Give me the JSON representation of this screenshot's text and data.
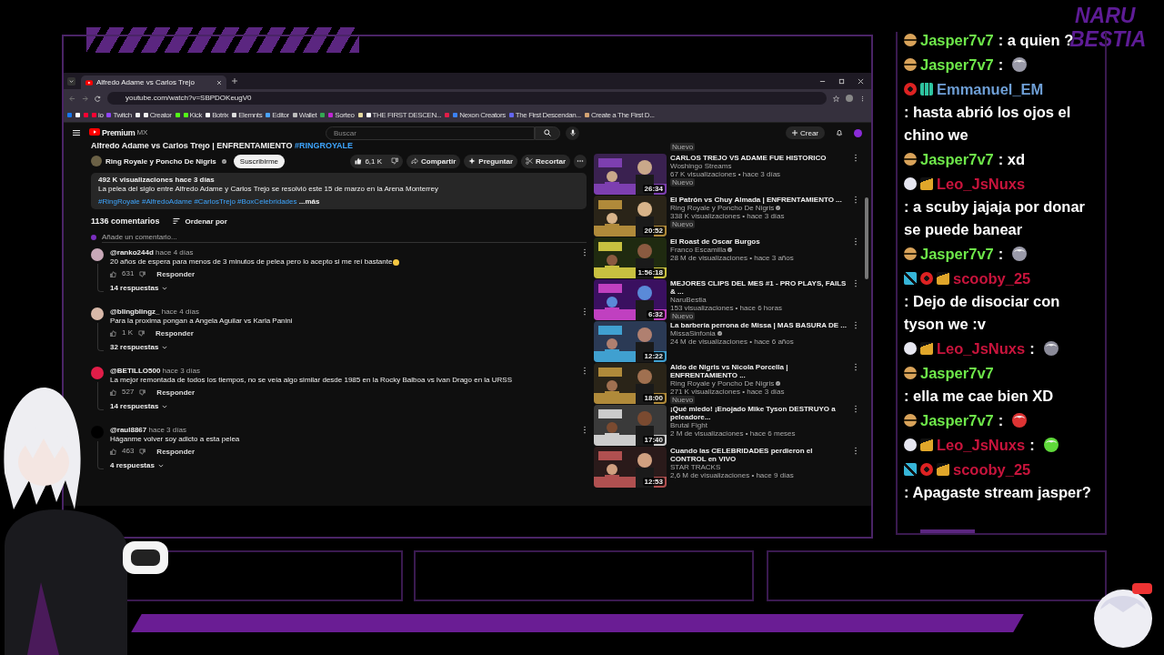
{
  "logo": {
    "line_1": "NARU",
    "line_2": "BESTIA"
  },
  "browser": {
    "tab_title": "Alfredo Adame vs Carlos Trejo",
    "url": "youtube.com/watch?v=SBPDOKeugV0",
    "bookmarks": [
      {
        "color": "#1877f2"
      },
      {
        "color": "#ffffff"
      },
      {
        "color": "#ff0033"
      },
      {
        "label": "io",
        "color": "#ff0033"
      },
      {
        "label": "Twitch",
        "color": "#9146ff"
      },
      {
        "color": "#eeeeee"
      },
      {
        "label": "Creator",
        "color": "#eeeeee"
      },
      {
        "color": "#53fc18"
      },
      {
        "label": "Kick",
        "color": "#53fc18"
      },
      {
        "label": "Botrix",
        "color": "#ffffff"
      },
      {
        "label": "Elemnts",
        "color": "#dddddd"
      },
      {
        "label": "Editor",
        "color": "#4aa3ff"
      },
      {
        "label": "Wallet",
        "color": "#bbbbbb"
      },
      {
        "color": "#34a853"
      },
      {
        "label": "Sorteo",
        "color": "#c026d3"
      },
      {
        "color": "#e5d9a0"
      },
      {
        "label": "THE FIRST DESCEN...",
        "color": "#ffffff"
      },
      {
        "color": "#e11d48"
      },
      {
        "label": "Nexon Creators",
        "color": "#3b82f6"
      },
      {
        "label": "The First Descendan...",
        "color": "#6366f1"
      },
      {
        "label": "Create a The First D...",
        "color": "#d4a373"
      }
    ]
  },
  "youtube": {
    "brand": "Premium",
    "region": "MX",
    "search_placeholder": "Buscar",
    "create_button": "Crear",
    "video_title": "Alfredo Adame vs Carlos Trejo | ENFRENTAMIENTO ",
    "video_hashtag": "#RINGROYALE",
    "channel": "Ring Royale y Poncho De Nigris",
    "subscribe": "Suscribirme",
    "likes": "6,1 K",
    "actions": [
      {
        "kind": "share",
        "label": "Compartir"
      },
      {
        "kind": "ask",
        "label": "Preguntar"
      },
      {
        "kind": "clip",
        "label": "Recortar"
      }
    ],
    "description": {
      "stats": "492 K visualizaciones  hace 3 días",
      "text": "La pelea del siglo entre Alfredo Adame y Carlos Trejo se resolvió este 15 de marzo en la Arena Monterrey",
      "hashtags": "#RingRoyale #AlfredoAdame #CarlosTrejo #BoxCelebridades",
      "more": "...más"
    },
    "comments_count": "1136 comentarios",
    "sort": "Ordenar por",
    "comment_placeholder": "Añade un comentario...",
    "comments": [
      {
        "author": "@ranko244d",
        "time": "hace 4 días",
        "text": "20 años de espera para menos de 3 minutos de pelea pero lo acepto si me reí bastante",
        "emoji": true,
        "likes": "631",
        "reply": "Responder",
        "replies": "14 respuestas"
      },
      {
        "author": "@blingblingz_",
        "time": "hace 4 días",
        "text": "Para la proxima pongan a Angela Aguilar vs Karla Panini",
        "emoji": false,
        "likes": "1 K",
        "reply": "Responder",
        "replies": "32 respuestas"
      },
      {
        "author": "@BETILLO500",
        "time": "hace 3 días",
        "text": "La mejor remontada de todos los tiempos, no se veía algo similar desde 1985 en la Rocky Balboa vs Ivan Drago en la URSS",
        "emoji": false,
        "likes": "527",
        "reply": "Responder",
        "replies": "14 respuestas"
      },
      {
        "author": "@raul8867",
        "time": "hace 3 días",
        "text": "Háganme volver soy adicto a esta pelea",
        "emoji": false,
        "likes": "463",
        "reply": "Responder",
        "replies": "4 respuestas"
      }
    ]
  },
  "sidebar": {
    "top_badge": "Nuevo",
    "videos": [
      {
        "title": "CARLOS TREJO VS ADAME FUE HISTORICO",
        "channel": "Woshingo Streams",
        "verified": false,
        "meta": "67 K visualizaciones • hace 3 días",
        "duration": "26:34",
        "badge": "Nuevo"
      },
      {
        "title": "El Patrón vs Chuy Almada | ENFRENTAMIENTO ...",
        "channel": "Ring Royale y Poncho De Nigris",
        "verified": true,
        "meta": "338 K visualizaciones • hace 3 días",
        "duration": "20:52",
        "badge": "Nuevo"
      },
      {
        "title": "El Roast de Oscar Burgos",
        "channel": "Franco Escamilla",
        "verified": true,
        "meta": "28 M de visualizaciones • hace 3 años",
        "duration": "1:56:18"
      },
      {
        "title": "MEJORES CLIPS DEL MES #1 - PRO PLAYS, FAILS & ...",
        "channel": "NaruBestia",
        "verified": false,
        "meta": "153 visualizaciones • hace 6 horas",
        "duration": "6:32",
        "badge": "Nuevo"
      },
      {
        "title": "La barbería perrona de Missa | MAS BASURA DE ...",
        "channel": "MissaSinfonia",
        "verified": true,
        "meta": "24 M de visualizaciones • hace 6 años",
        "duration": "12:22"
      },
      {
        "title": "Aldo de Nigris vs Nicola Porcella | ENFRENTAMIENTO ...",
        "channel": "Ring Royale y Poncho De Nigris",
        "verified": true,
        "meta": "271 K visualizaciones • hace 3 días",
        "duration": "18:00",
        "badge": "Nuevo"
      },
      {
        "title": "¡Qué miedo! ¡Enojado Mike Tyson DESTRUYO a peleadore...",
        "channel": "Brutal Fight",
        "verified": false,
        "meta": "2 M de visualizaciones • hace 6 meses",
        "duration": "17:40"
      },
      {
        "title": "Cuando las CELEBRIDADES perdieron el CONTROL en VIVO",
        "channel": "STAR TRACKS",
        "verified": false,
        "meta": "2,6 M de visualizaciones • hace 9 días",
        "duration": "12:53"
      }
    ]
  },
  "chat": [
    {
      "badges": [
        {
          "kind": "minus"
        }
      ],
      "user": "Jasper7v7",
      "color": "#6ee84a",
      "text": ": a quien ?"
    },
    {
      "badges": [
        {
          "kind": "minus"
        }
      ],
      "user": "Jasper7v7",
      "color": "#6ee84a",
      "text": ":",
      "emote": {
        "color": "#9a9aa8"
      }
    },
    {
      "badges": [
        {
          "kind": "eye"
        },
        {
          "kind": "grid"
        }
      ],
      "user": "Emmanuel_EM",
      "color": "#6e9fd6",
      "text": ": hasta abrió los ojos el chino we"
    },
    {
      "badges": [
        {
          "kind": "minus"
        }
      ],
      "user": "Jasper7v7",
      "color": "#6ee84a",
      "text": ": xd"
    },
    {
      "badges": [
        {
          "kind": "circle"
        },
        {
          "kind": "crown"
        }
      ],
      "user": "Leo_JsNuxs",
      "color": "#c8143c",
      "text": ": a scuby jajaja por donar se puede banear"
    },
    {
      "badges": [
        {
          "kind": "minus"
        }
      ],
      "user": "Jasper7v7",
      "color": "#6ee84a",
      "text": ":",
      "emote": {
        "color": "#9a9aa9"
      }
    },
    {
      "badges": [
        {
          "kind": "hammer"
        },
        {
          "kind": "eye"
        },
        {
          "kind": "crown"
        }
      ],
      "user": "scooby_25",
      "color": "#c8143c",
      "text": ": Dejo de disociar con tyson we :v"
    },
    {
      "badges": [
        {
          "kind": "circle"
        },
        {
          "kind": "crown"
        }
      ],
      "user": "Leo_JsNuxs",
      "color": "#c8143c",
      "text": ":",
      "emote": {
        "color": "#8a8a98"
      }
    },
    {
      "badges": [
        {
          "kind": "minus"
        }
      ],
      "user": "Jasper7v7",
      "color": "#6ee84a",
      "text": ": ella me cae bien XD"
    },
    {
      "badges": [
        {
          "kind": "minus"
        }
      ],
      "user": "Jasper7v7",
      "color": "#6ee84a",
      "text": ":",
      "emote": {
        "color": "#dd3333"
      }
    },
    {
      "badges": [
        {
          "kind": "circle"
        },
        {
          "kind": "crown"
        }
      ],
      "user": "Leo_JsNuxs",
      "color": "#c8143c",
      "text": ":",
      "emote": {
        "color": "#5fd93a"
      }
    },
    {
      "badges": [
        {
          "kind": "hammer"
        },
        {
          "kind": "eye"
        },
        {
          "kind": "crown"
        }
      ],
      "user": "scooby_25",
      "color": "#c8143c",
      "text": ": Apagaste stream jasper?"
    }
  ]
}
